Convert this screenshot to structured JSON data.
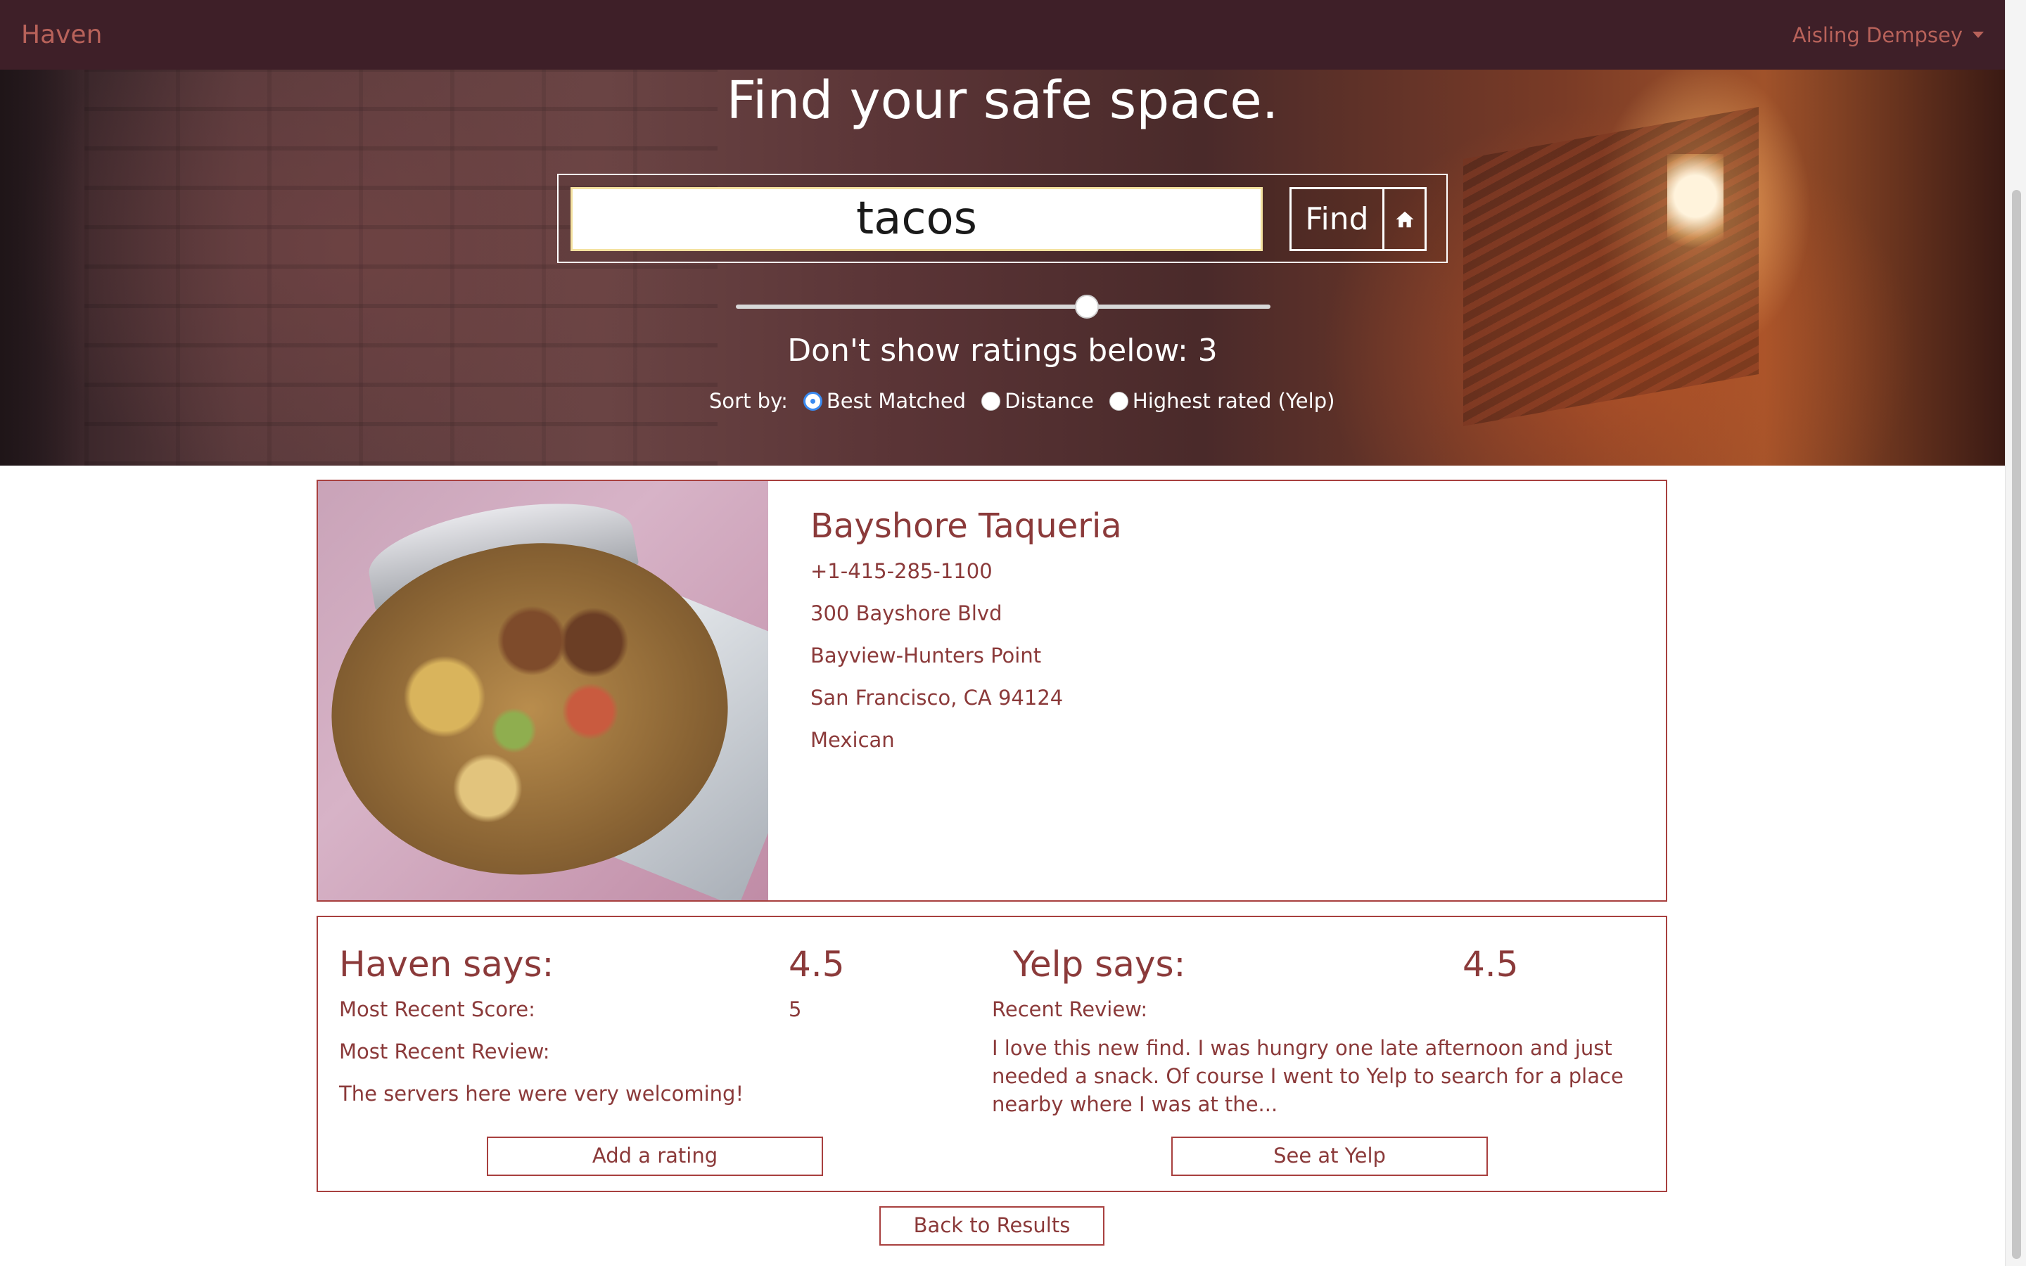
{
  "navbar": {
    "brand": "Haven",
    "user_name": "Aisling Dempsey"
  },
  "hero": {
    "title": "Find your safe space.",
    "search_value": "tacos",
    "find_label": "Find",
    "min_rating": 3,
    "min_rating_label": "Don't show ratings below: 3",
    "sort_label": "Sort by:",
    "sort_options": [
      {
        "label": "Best Matched",
        "selected": true
      },
      {
        "label": "Distance",
        "selected": false
      },
      {
        "label": "Highest rated (Yelp)",
        "selected": false
      }
    ]
  },
  "place": {
    "name": "Bayshore Taqueria",
    "phone": "+1-415-285-1100",
    "address": "300 Bayshore Blvd",
    "neighborhood": "Bayview-Hunters Point",
    "city": "San Francisco, CA 94124",
    "category": "Mexican"
  },
  "haven": {
    "heading": "Haven says:",
    "score": "4.5",
    "recent_score_label": "Most Recent Score:",
    "recent_score": "5",
    "recent_review_label": "Most Recent Review:",
    "recent_review": "The servers here were very welcoming!",
    "add_rating_label": "Add a rating"
  },
  "yelp": {
    "heading": "Yelp says:",
    "score": "4.5",
    "recent_review_label": "Recent Review:",
    "recent_review": "I love this new find. I was hungry one late afternoon and just needed a snack. Of course I went to Yelp to search for a place nearby where I was at the...",
    "see_label": "See at Yelp"
  },
  "footer": {
    "back_label": "Back to Results"
  },
  "colors": {
    "navbar_bg": "#3e1f28",
    "accent": "#8b3a3a",
    "border": "#a8403f",
    "radio_selected": "#3a8af0"
  }
}
